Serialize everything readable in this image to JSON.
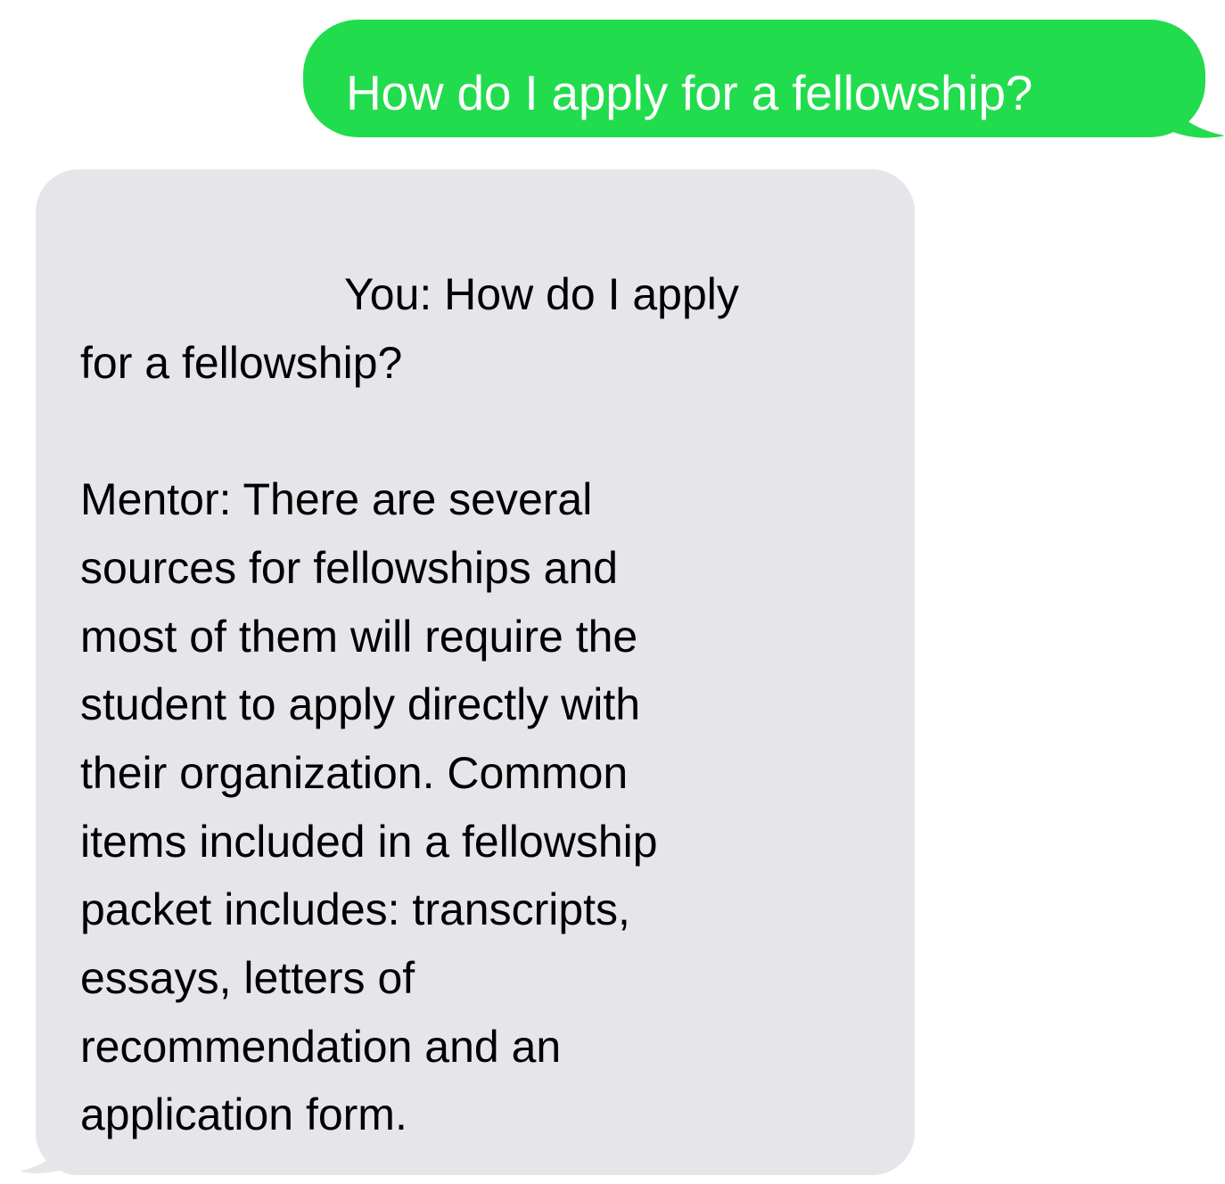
{
  "messages": [
    {
      "direction": "sent",
      "text": "How do I apply for a fellowship?"
    },
    {
      "direction": "received",
      "lines": [
        "You: How do I apply",
        "for a fellowship?",
        "",
        "Mentor: There are several",
        "sources for fellowships and",
        "most of them will require the",
        "student to apply directly with",
        "their organization. Common",
        "items included in a fellowship",
        "packet includes: transcripts,",
        "essays, letters of",
        "recommendation and an",
        "application form."
      ]
    }
  ],
  "colors": {
    "sent_bubble": "#21dc4d",
    "sent_text": "#ffffff",
    "received_bubble": "#e5e5ea",
    "received_text": "#000000",
    "background": "#ffffff"
  }
}
